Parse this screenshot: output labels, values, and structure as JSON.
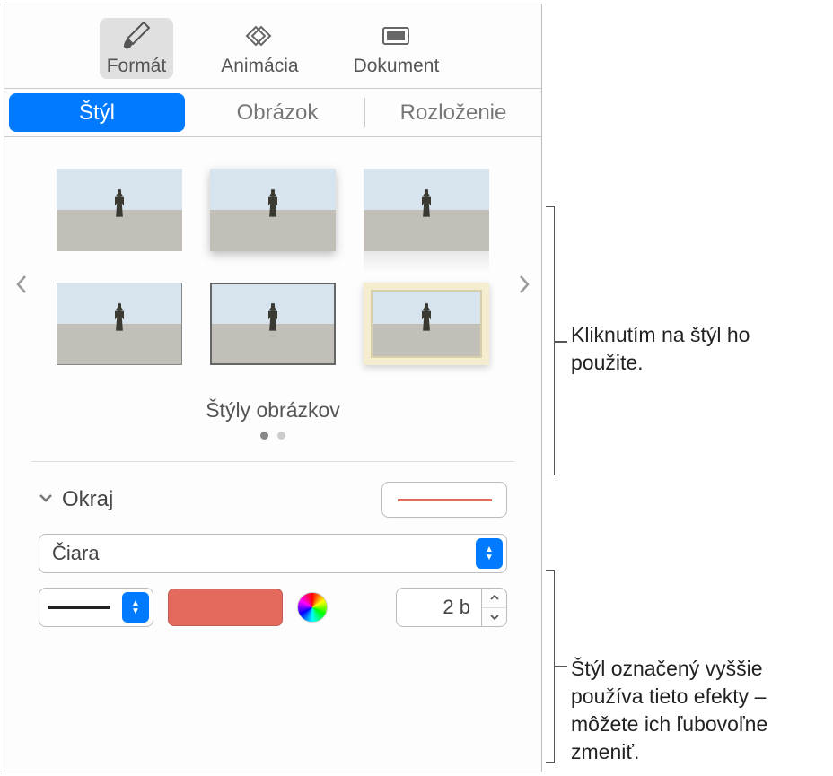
{
  "toolbar": {
    "format": "Formát",
    "animation": "Animácia",
    "document": "Dokument"
  },
  "subtabs": {
    "style": "Štýl",
    "image": "Obrázok",
    "layout": "Rozloženie"
  },
  "styles": {
    "title": "Štýly obrázkov"
  },
  "border": {
    "section_label": "Okraj",
    "type_label": "Čiara",
    "width_value": "2 b",
    "color": "#e46a5e"
  },
  "callouts": {
    "apply_style": "Kliknutím na štýl ho použite.",
    "effects_note": "Štýl označený vyššie používa tieto efekty – môžete ich ľubovoľne zmeniť."
  }
}
